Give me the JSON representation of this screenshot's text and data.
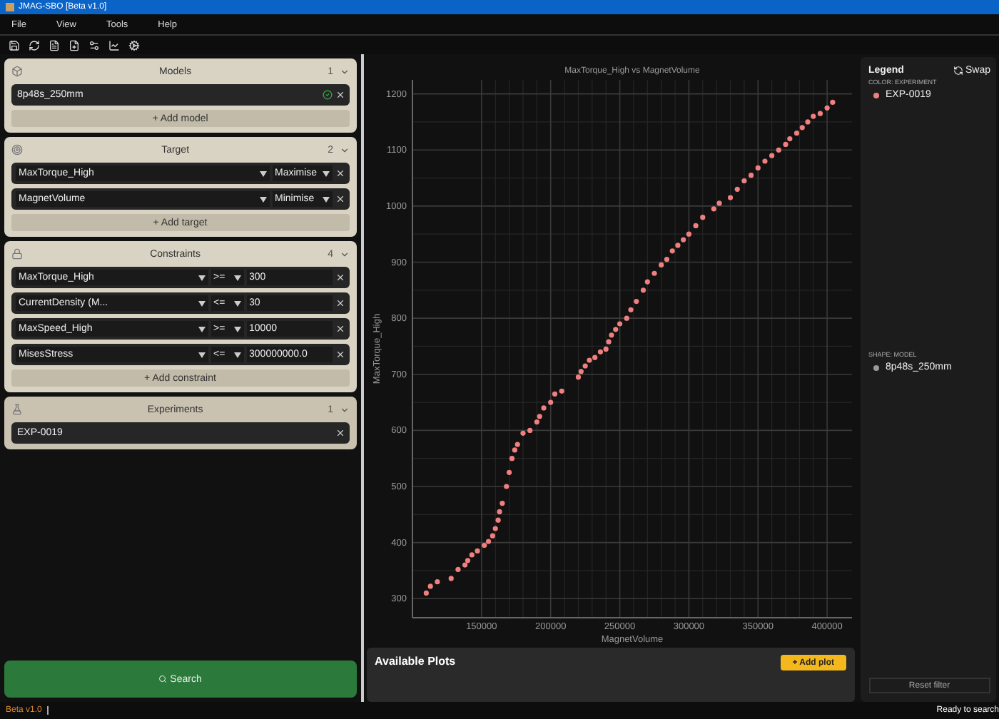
{
  "window": {
    "title": "JMAG-SBO [Beta v1.0]"
  },
  "menu": [
    "File",
    "View",
    "Tools",
    "Help"
  ],
  "sections": [
    {
      "kind": "models",
      "title": "Models",
      "count": "1",
      "rows": [
        {
          "kind": "model",
          "name": "8p48s_250mm"
        }
      ],
      "add": "+ Add model"
    },
    {
      "kind": "target",
      "title": "Target",
      "count": "2",
      "rows": [
        {
          "kind": "target",
          "name": "MaxTorque_High",
          "mode": "Maximise"
        },
        {
          "kind": "target",
          "name": "MagnetVolume",
          "mode": "Minimise"
        }
      ],
      "add": "+ Add target"
    },
    {
      "kind": "constraints",
      "title": "Constraints",
      "count": "4",
      "rows": [
        {
          "kind": "constraint",
          "name": "MaxTorque_High",
          "op": ">=",
          "value": "300"
        },
        {
          "kind": "constraint",
          "name": "CurrentDensity (M...",
          "op": "<=",
          "value": "30"
        },
        {
          "kind": "constraint",
          "name": "MaxSpeed_High",
          "op": ">=",
          "value": "10000"
        },
        {
          "kind": "constraint",
          "name": "MisesStress",
          "op": "<=",
          "value": "300000000.0"
        }
      ],
      "add": "+ Add constraint"
    },
    {
      "kind": "experiments",
      "title": "Experiments",
      "count": "1",
      "rows": [
        {
          "kind": "experiment",
          "name": "EXP-0019"
        }
      ]
    }
  ],
  "search_button": "Search",
  "plot": {
    "chart_data": {
      "type": "scatter",
      "title": "MaxTorque_High vs MagnetVolume",
      "xlabel": "MagnetVolume",
      "ylabel": "MaxTorque_High",
      "xlim": [
        100000,
        418000
      ],
      "ylim": [
        266,
        1225
      ],
      "xticks": [
        150000,
        200000,
        250000,
        300000,
        350000,
        400000
      ],
      "yticks": [
        300,
        400,
        500,
        600,
        700,
        800,
        900,
        1000,
        1100,
        1200
      ],
      "grid": true,
      "series": [
        {
          "name": "EXP-0019",
          "color": "#f08080",
          "x": [
            110000,
            113000,
            118000,
            128000,
            133000,
            138000,
            140000,
            143000,
            147000,
            152000,
            155000,
            158000,
            160000,
            162000,
            163000,
            165000,
            168000,
            170000,
            172000,
            174000,
            176000,
            180000,
            185000,
            190000,
            192000,
            195000,
            200000,
            203000,
            208000,
            220000,
            222000,
            225000,
            228000,
            232000,
            236000,
            240000,
            242000,
            244000,
            247000,
            250000,
            255000,
            258000,
            262000,
            267000,
            270000,
            275000,
            280000,
            284000,
            288000,
            292000,
            296000,
            300000,
            305000,
            310000,
            318000,
            322000,
            330000,
            335000,
            340000,
            345000,
            350000,
            355000,
            360000,
            365000,
            370000,
            373000,
            378000,
            382000,
            386000,
            390000,
            395000,
            400000,
            404000
          ],
          "values": [
            310,
            322,
            330,
            336,
            352,
            360,
            368,
            378,
            385,
            395,
            402,
            412,
            425,
            440,
            455,
            470,
            500,
            525,
            550,
            565,
            575,
            595,
            600,
            615,
            625,
            640,
            650,
            665,
            670,
            695,
            705,
            715,
            725,
            730,
            740,
            745,
            758,
            770,
            780,
            790,
            800,
            815,
            830,
            850,
            865,
            880,
            895,
            905,
            920,
            930,
            940,
            950,
            965,
            980,
            995,
            1005,
            1015,
            1030,
            1045,
            1055,
            1068,
            1080,
            1090,
            1100,
            1110,
            1120,
            1130,
            1140,
            1150,
            1160,
            1165,
            1175,
            1185
          ]
        }
      ]
    }
  },
  "available_plots": {
    "title": "Available Plots",
    "add": "+ Add plot"
  },
  "legend": {
    "title": "Legend",
    "swap": "Swap",
    "groups": [
      {
        "kind": "color",
        "heading": "COLOR: EXPERIMENT"
      },
      {
        "kind": "shape",
        "heading": "SHAPE: MODEL",
        "items": [
          {
            "label": "8p48s_250mm",
            "color": "#9a9a9a"
          }
        ]
      }
    ],
    "reset": "Reset filter"
  },
  "status_bar": {
    "version": "Beta v1.0",
    "message": "Ready to search"
  }
}
